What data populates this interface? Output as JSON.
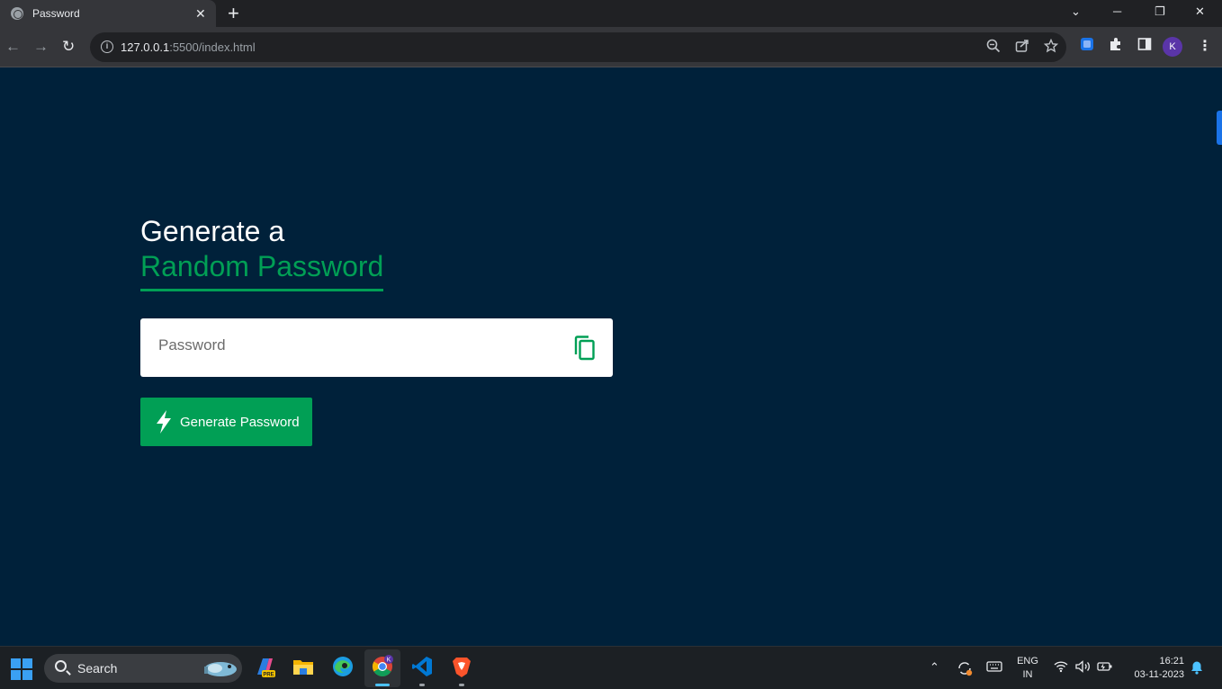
{
  "browser": {
    "tab_title": "Password",
    "tab_close": "✕",
    "new_tab": "+",
    "url_host": "127.0.0.1",
    "url_rest": ":5500/index.html",
    "profile_initial": "K",
    "icons": [
      "globe-icon",
      "back-icon",
      "forward-icon",
      "reload-icon",
      "info-icon",
      "zoom-icon",
      "share-icon",
      "star-icon",
      "extension-icon",
      "puzzle-icon",
      "sidepanel-icon",
      "menu-icon"
    ]
  },
  "window_controls": {
    "dropdown": "⌄",
    "minimize": "─",
    "restore": "❐",
    "close": "✕"
  },
  "page": {
    "heading_line1": "Generate a",
    "heading_line2": "Random Password",
    "password_placeholder": "Password",
    "generate_button": "Generate Password",
    "accent_color": "#019f55",
    "background_color": "#00213a"
  },
  "taskbar": {
    "search_label": "Search",
    "language_line1": "ENG",
    "language_line2": "IN",
    "time": "16:21",
    "date": "03-11-2023",
    "apps": [
      "copilot-icon",
      "file-explorer-icon",
      "edge-icon",
      "chrome-icon",
      "vscode-icon",
      "brave-icon"
    ]
  }
}
